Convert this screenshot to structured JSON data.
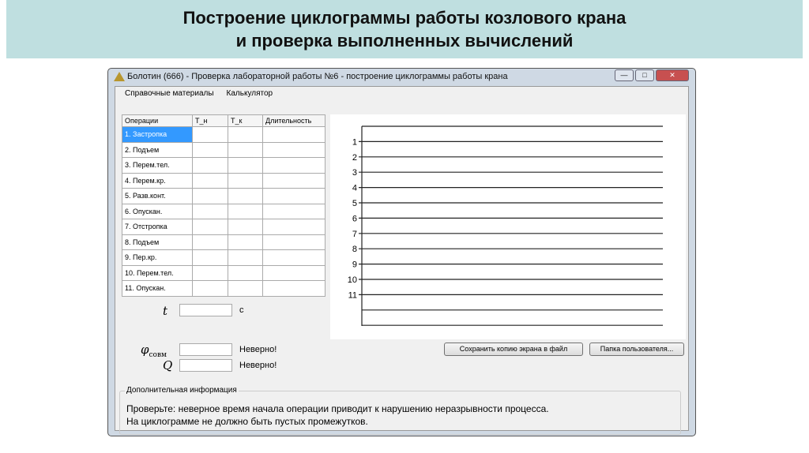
{
  "slide": {
    "title_line1": "Построение циклограммы работы козлового крана",
    "title_line2": "и проверка выполненных вычислений"
  },
  "window": {
    "title": "Болотин (666) - Проверка лабораторной работы №6 - построение циклограммы работы крана",
    "minimize": "—",
    "maximize": "□",
    "close": "✕"
  },
  "menu": [
    "Справочные материалы",
    "Калькулятор"
  ],
  "table": {
    "headers": [
      "Операции",
      "T_н",
      "T_к",
      "Длительность"
    ],
    "rows": [
      "1. Застропка",
      "2. Подъем",
      "3. Перем.тел.",
      "4. Перем.кр.",
      "5. Разв.конт.",
      "6. Опускан.",
      "7. Отстропка",
      "8. Подъем",
      "9. Пер.кр.",
      "10. Перем.тел.",
      "11. Опускан."
    ]
  },
  "chart_labels": [
    "1",
    "2",
    "3",
    "4",
    "5",
    "6",
    "7",
    "8",
    "9",
    "10",
    "11"
  ],
  "fields": {
    "t_label": "t",
    "t_unit": "с",
    "phi_label": "φ",
    "phi_sub": "совм",
    "phi_status": "Неверно!",
    "q_label": "Q",
    "q_status": "Неверно!"
  },
  "buttons": {
    "save": "Сохранить копию экрана в файл",
    "folder": "Папка пользователя..."
  },
  "info": {
    "title": "Дополнительная информация",
    "line1": "Проверьте: неверное время начала операции приводит к нарушению неразрывности процесса.",
    "line2": "На циклограмме не должно быть пустых промежутков."
  }
}
